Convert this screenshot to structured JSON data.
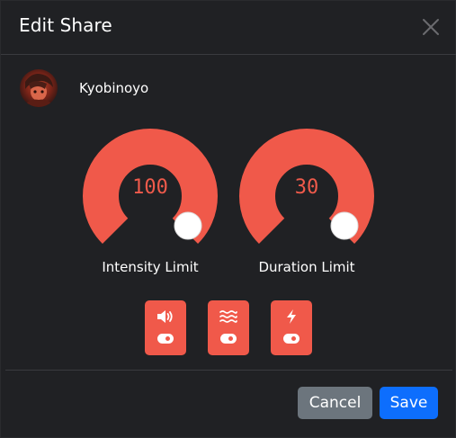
{
  "dialog": {
    "title": "Edit Share"
  },
  "user": {
    "name": "Kyobinoyo"
  },
  "limits": [
    {
      "label": "Intensity Limit",
      "value": "100",
      "fraction": 1.0
    },
    {
      "label": "Duration Limit",
      "value": "30",
      "fraction": 1.0
    }
  ],
  "permissions": [
    {
      "icon": "volume-icon",
      "enabled": true
    },
    {
      "icon": "vibrate-waves-icon",
      "enabled": true
    },
    {
      "icon": "lightning-icon",
      "enabled": true
    }
  ],
  "footer": {
    "cancel_label": "Cancel",
    "save_label": "Save"
  },
  "colors": {
    "accent": "#f0594a",
    "background": "#202124",
    "cancel": "#6c757d",
    "save": "#0d6efd"
  }
}
